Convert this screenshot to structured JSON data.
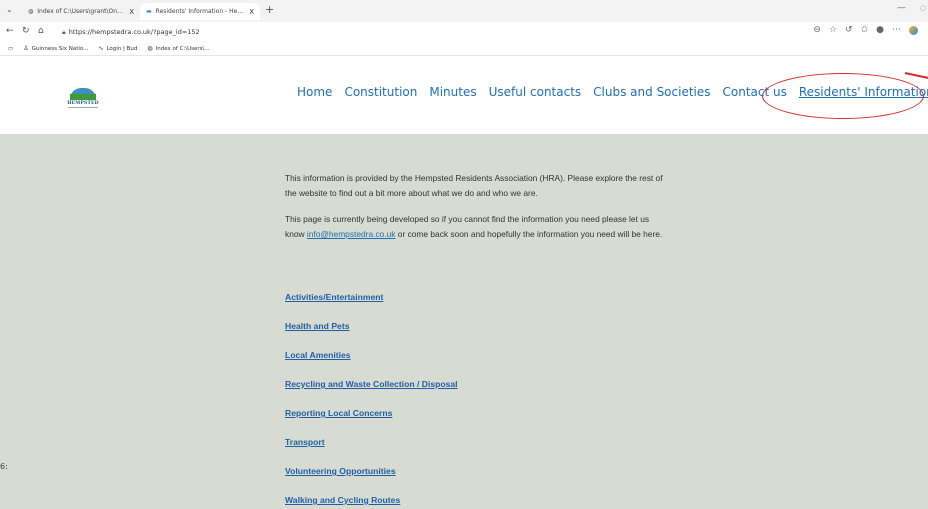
{
  "browser": {
    "tabs": [
      {
        "title": "Index of C:\\Users\\grant\\OneDrive\\",
        "close": "X"
      },
      {
        "title": "Residents' Information - Hempsted",
        "close": "X"
      }
    ],
    "new_tab": "+",
    "url": "https://hempstedra.co.uk/?page_id=152",
    "favorites": [
      {
        "label": "Guinness Six Natio..."
      },
      {
        "label": "Login | Bud"
      },
      {
        "label": "Index of C:\\Users\\..."
      }
    ]
  },
  "site": {
    "logo_text": "HEMPSTED",
    "nav": [
      {
        "label": "Home"
      },
      {
        "label": "Constitution"
      },
      {
        "label": "Minutes"
      },
      {
        "label": "Useful contacts"
      },
      {
        "label": "Clubs and Societies"
      },
      {
        "label": "Contact us"
      },
      {
        "label": "Residents' Information"
      }
    ]
  },
  "content": {
    "paragraph1": "This information is provided by the Hempsted Residents Association (HRA). Please explore the rest of the website to find out a bit more about what we do and who we are.",
    "paragraph2_before": "This page is currently being developed so if you cannot find the information you need please let us know ",
    "email": "info@hempstedra.co.uk",
    "paragraph2_after": " or come back soon and hopefully the information you need will be here.",
    "links": [
      {
        "label": "Activities/Entertainment"
      },
      {
        "label": "Health and Pets"
      },
      {
        "label": "Local Amenities"
      },
      {
        "label": "Recycling and Waste Collection / Disposal"
      },
      {
        "label": "Reporting Local Concerns"
      },
      {
        "label": "Transport"
      },
      {
        "label": "Volunteering Opportunities"
      },
      {
        "label": "Walking and Cycling Routes"
      }
    ],
    "stray_char": "6:"
  },
  "colors": {
    "nav_link": "#1f6fb0",
    "content_bg": "#d7dbd1",
    "annotation": "#d12b2b"
  }
}
